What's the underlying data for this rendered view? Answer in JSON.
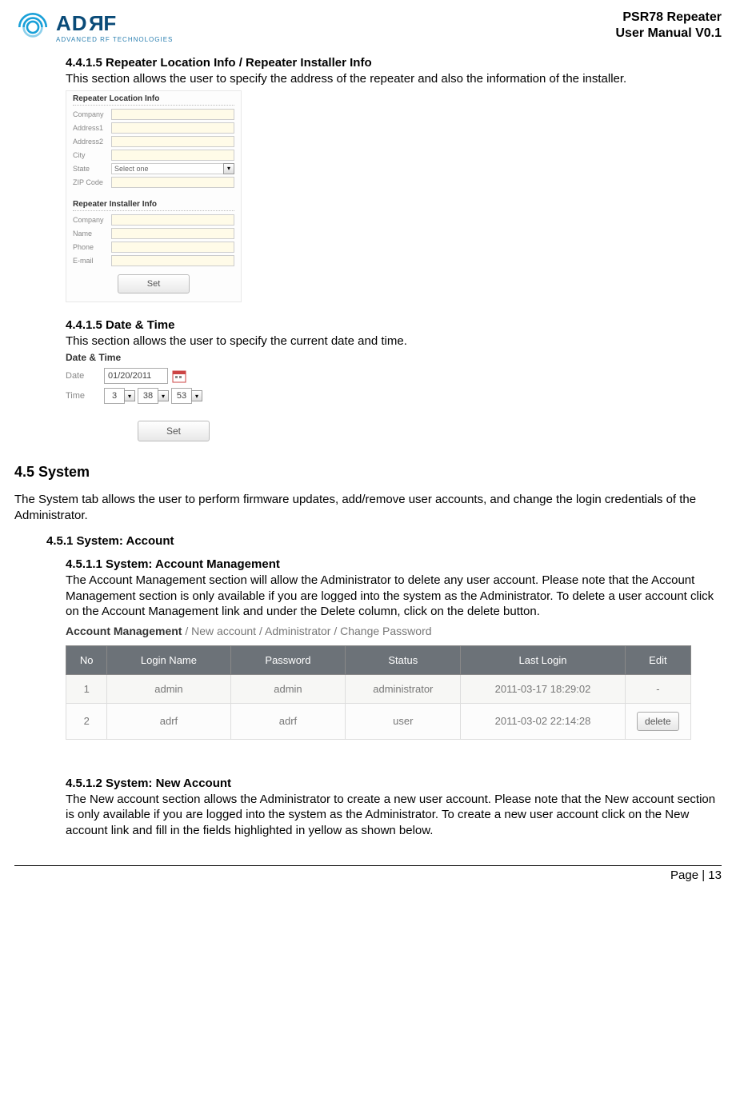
{
  "header": {
    "brand_a": "AD",
    "brand_r": "R",
    "brand_f": "F",
    "tagline": "ADVANCED RF TECHNOLOGIES",
    "doc_line1": "PSR78 Repeater",
    "doc_line2": "User Manual V0.1"
  },
  "s4415a": {
    "heading": "4.4.1.5 Repeater Location Info / Repeater Installer Info",
    "desc": "This section allows the user to specify the address of the repeater and also the information of the installer."
  },
  "loc_form": {
    "title": "Repeater Location Info",
    "l_company": "Company",
    "l_addr1": "Address1",
    "l_addr2": "Address2",
    "l_city": "City",
    "l_state": "State",
    "state_val": "Select one",
    "l_zip": "ZIP Code"
  },
  "inst_form": {
    "title": "Repeater Installer Info",
    "l_company": "Company",
    "l_name": "Name",
    "l_phone": "Phone",
    "l_email": "E-mail",
    "set_btn": "Set"
  },
  "s4415b": {
    "heading": "4.4.1.5 Date & Time",
    "desc": "This section allows the user to specify the current date and time."
  },
  "dt": {
    "title": "Date & Time",
    "l_date": "Date",
    "date_val": "01/20/2011",
    "l_time": "Time",
    "h": "3",
    "m": "38",
    "s": "53",
    "set_btn": "Set"
  },
  "s45": {
    "heading": "4.5 System",
    "desc": "The System tab allows the user to perform firmware updates, add/remove user accounts, and change the login credentials of the Administrator."
  },
  "s451": {
    "heading": "4.5.1 System: Account"
  },
  "s4511": {
    "heading": "4.5.1.1 System: Account Management",
    "desc": "The Account Management section will allow the Administrator to delete any user account.    Please note that the Account Management section is only available if you are logged into the system as the Administrator.    To delete a user account click on the Account Management link and under the Delete column, click on the delete button."
  },
  "nav": {
    "active": "Account Management",
    "sep1": " / ",
    "n2": "New account",
    "sep2": " / ",
    "n3": "Administrator",
    "sep3": " / ",
    "n4": "Change Password"
  },
  "table": {
    "h_no": "No",
    "h_login": "Login Name",
    "h_pw": "Password",
    "h_status": "Status",
    "h_last": "Last Login",
    "h_edit": "Edit",
    "rows": [
      {
        "no": "1",
        "login": "admin",
        "pw": "admin",
        "status": "administrator",
        "last": "2011-03-17 18:29:02",
        "edit": "-"
      },
      {
        "no": "2",
        "login": "adrf",
        "pw": "adrf",
        "status": "user",
        "last": "2011-03-02 22:14:28",
        "edit": "delete"
      }
    ]
  },
  "s4512": {
    "heading": "4.5.1.2 System: New Account",
    "desc": "The New account section allows the Administrator to create a new user account.    Please note that the New account section is only available if you are logged into the system as the Administrator.    To create a new user account click on the New account link and fill in the fields highlighted in yellow as shown below."
  },
  "footer": {
    "text": "Page | 13"
  }
}
